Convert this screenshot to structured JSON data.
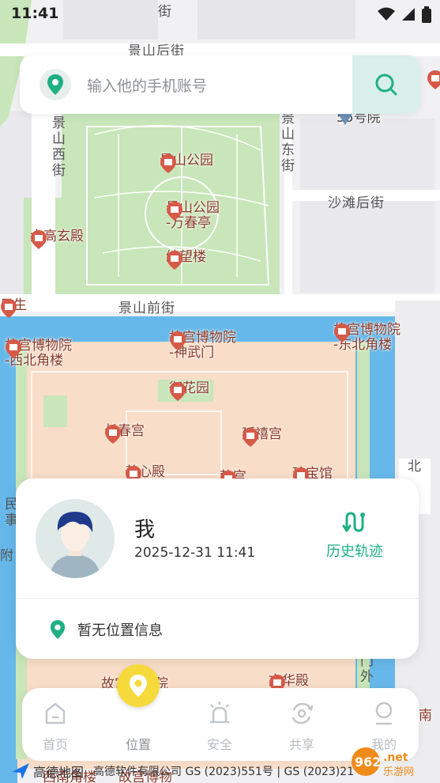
{
  "status": {
    "time": "11:41"
  },
  "map": {
    "streets": {
      "jingshan_hou": "景山后街",
      "jingshan_xi": "景山西街",
      "jingshan_dong": "景山东街",
      "shatan_hou": "沙滩后街",
      "jingshan_qian": "景山前街",
      "top_char": "街",
      "bei": "北",
      "min": "民事",
      "fu": "附",
      "men": "门外"
    },
    "pois": {
      "jingshan_park": "景山公园",
      "wanchun_l1": "景山公园",
      "wanchun_l2": "-万春亭",
      "daguo": "大高玄殿",
      "qiwang": "绮望楼",
      "rishang": "日生",
      "gugong_xb_l1": "故宫博物院",
      "gugong_xb_l2": "-西北角楼",
      "gugong_sw_l1": "故宫博物院",
      "gugong_sw_l2": "-神武门",
      "gugong_db_l1": "故宫博物院",
      "gugong_db_l2": "-东北角楼",
      "yuhuayuan": "御花园",
      "changchun": "长春宫",
      "yanxi": "延禧宫",
      "yangxin": "养心殿",
      "qiangong": "乾宫",
      "zhenbao": "珍宝馆",
      "no55": "55号院",
      "wenhua": "文华殿",
      "gugong_bottom": "故宫博物院",
      "xinan": "西南角楼",
      "gugong_b2": "故宫博物",
      "nan": "南"
    }
  },
  "search": {
    "placeholder": "输入他的手机账号"
  },
  "card": {
    "name": "我",
    "time": "2025-12-31 11:41",
    "history_label": "历史轨迹",
    "no_location": "暂无位置信息"
  },
  "nav": {
    "items": [
      {
        "label": "首页",
        "icon": "home-icon"
      },
      {
        "label": "位置",
        "icon": "location-pin-icon"
      },
      {
        "label": "安全",
        "icon": "alarm-icon"
      },
      {
        "label": "共享",
        "icon": "share-icon"
      },
      {
        "label": "我的",
        "icon": "profile-icon"
      }
    ]
  },
  "footer": {
    "logo": "高德地图",
    "copyright": "高德软件有限公司 GS (2023)551号 | GS (2023)21"
  },
  "watermark": "962.net 乐游网",
  "colors": {
    "accent_green": "#20b082",
    "nav_active_yellow": "#f6d93a",
    "park_green": "#c8e6b9",
    "palace_peach": "#f8ddc8",
    "moat_blue": "#67b8ea"
  }
}
